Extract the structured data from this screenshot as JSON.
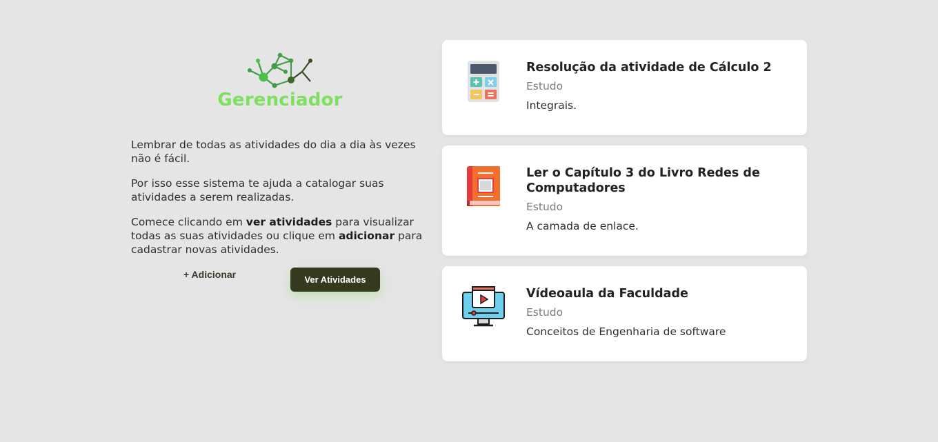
{
  "brand": {
    "name": "Gerenciador",
    "color": "#7ee05f"
  },
  "intro": {
    "p1": "Lembrar de todas as atividades do dia a dia às vezes não é fácil.",
    "p2": "Por isso esse sistema te ajuda a catalogar suas atividades a serem realizadas.",
    "p3_a": "Comece clicando em ",
    "p3_b": "ver atividades",
    "p3_c": " para visualizar todas as suas atividades ou clique em ",
    "p3_d": "adicionar",
    "p3_e": " para cadastrar novas atividades."
  },
  "actions": {
    "add_label": "+ Adicionar",
    "view_label": "Ver Atividades"
  },
  "activities": [
    {
      "title": "Resolução da atividade de Cálculo 2",
      "category": "Estudo",
      "description": "Integrais.",
      "icon": "calculator-icon"
    },
    {
      "title": "Ler o Capítulo 3 do Livro Redes de Computadores",
      "category": "Estudo",
      "description": "A camada de enlace.",
      "icon": "book-icon"
    },
    {
      "title": "Vídeoaula da Faculdade",
      "category": "Estudo",
      "description": "Conceitos de Engenharia de software",
      "icon": "video-lesson-icon"
    }
  ],
  "colors": {
    "background": "#e5e5e5",
    "primary_button": "#353a1e",
    "card": "#ffffff"
  }
}
